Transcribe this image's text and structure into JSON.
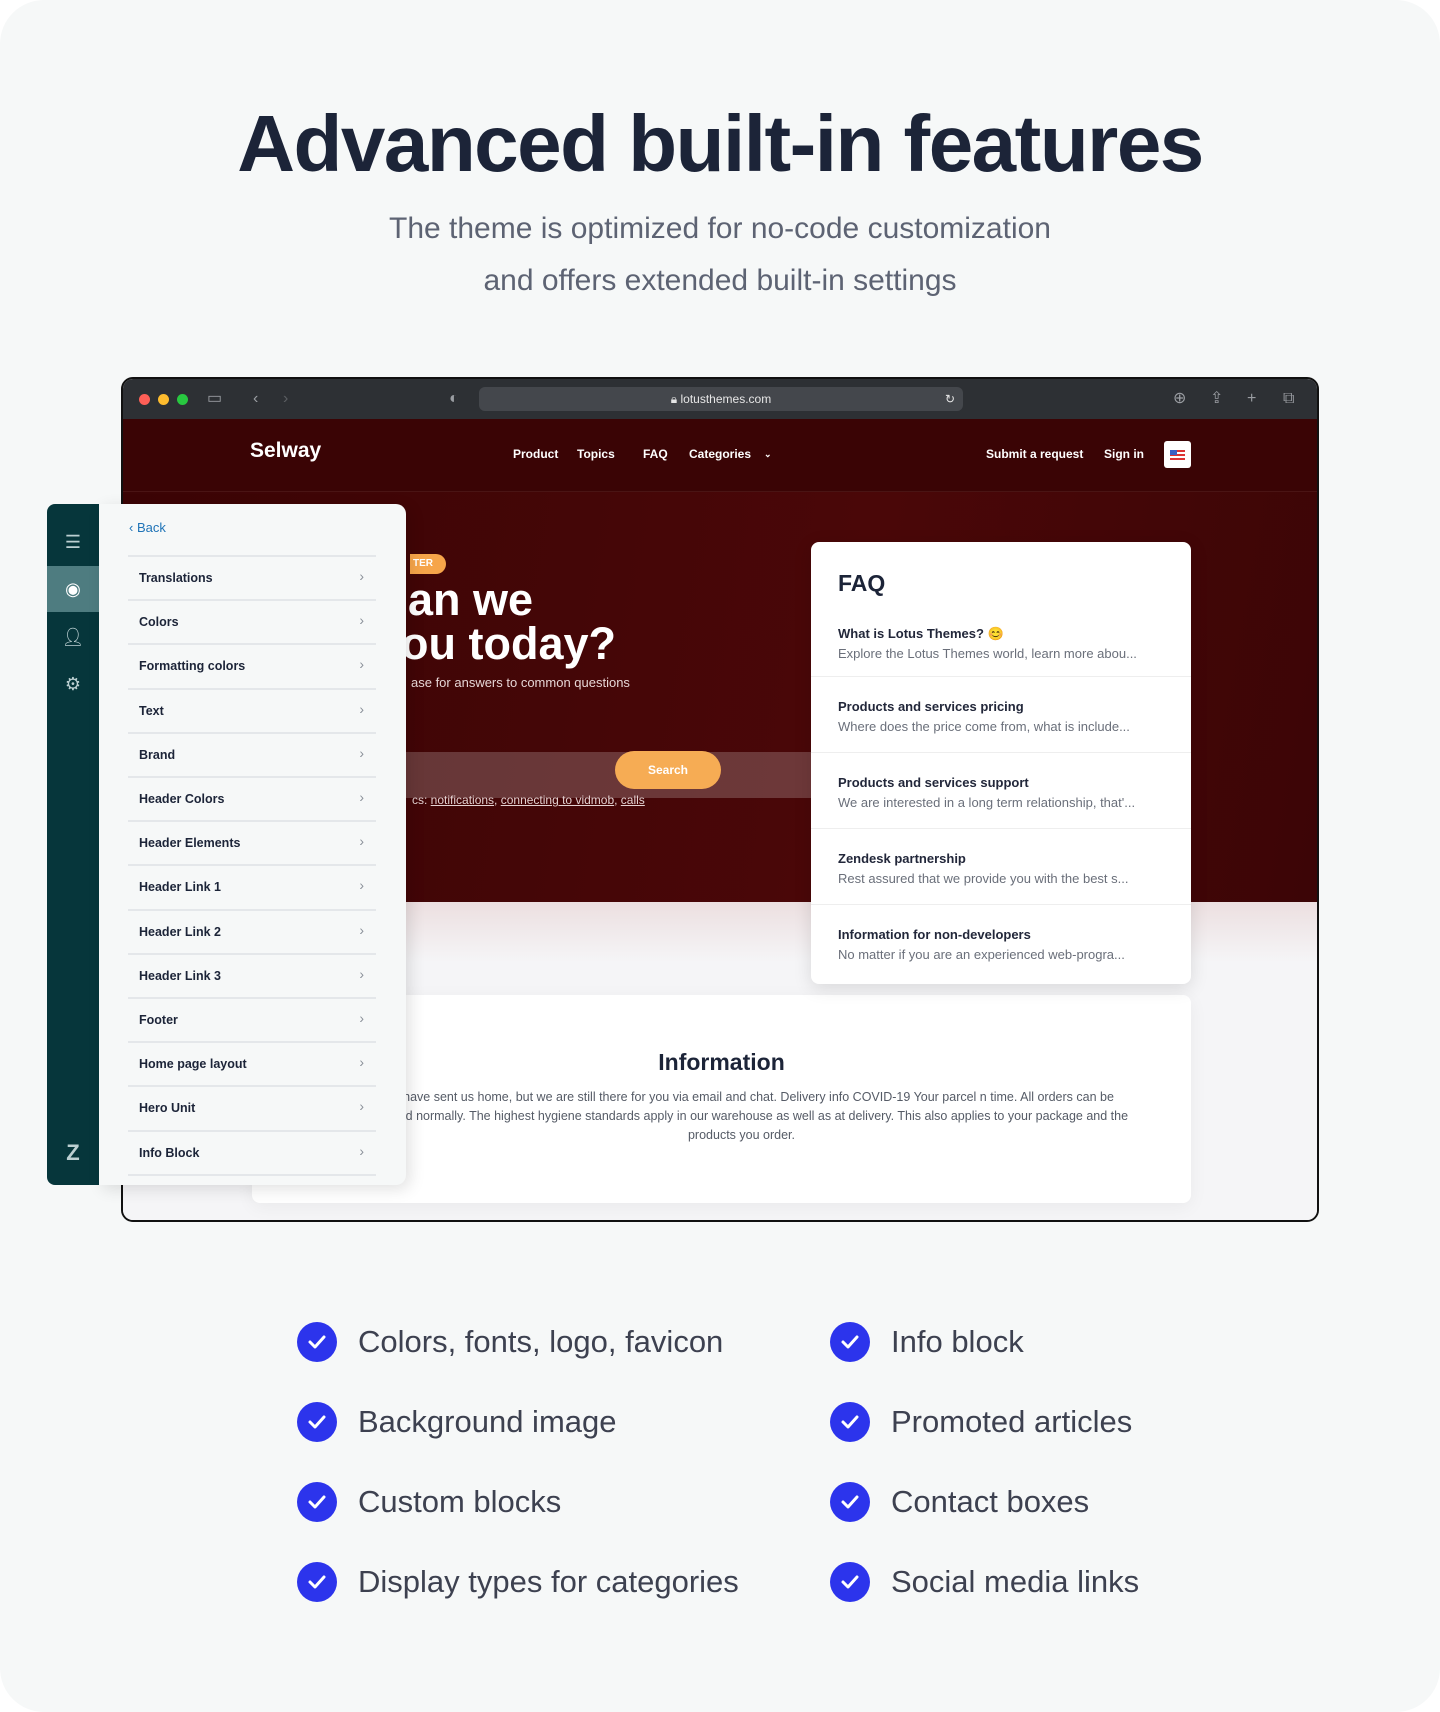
{
  "hero_section": {
    "title": "Advanced built-in features",
    "subtitle_lines": [
      "The theme is optimized for no-code customization",
      "and offers extended built-in settings"
    ]
  },
  "browser": {
    "url": "lotusthemes.com"
  },
  "site": {
    "logo": "Selway",
    "nav": [
      "Product",
      "Topics",
      "FAQ",
      "Categories"
    ],
    "submit": "Submit a request",
    "signin": "Sign in",
    "hero": {
      "badge": "TER",
      "line1": "an we",
      "line2": "ou today?",
      "subtitle": "ase for answers to common questions",
      "search_button": "Search",
      "popular_prefix": "cs: ",
      "popular": [
        "notifications",
        "connecting to vidmob",
        "calls"
      ]
    },
    "faq": {
      "title": "FAQ",
      "items": [
        {
          "q": "What is Lotus Themes? 😊",
          "a": "Explore the Lotus Themes world, learn more abou..."
        },
        {
          "q": "Products and services pricing",
          "a": "Where does the price come from, what is include..."
        },
        {
          "q": "Products and services support",
          "a": "We are interested in a long term relationship, that'..."
        },
        {
          "q": "Zendesk partnership",
          "a": "Rest assured that we provide you with the best s..."
        },
        {
          "q": "Information for non-developers",
          "a": "No matter if you are an experienced web-progra..."
        }
      ]
    },
    "info": {
      "title": "Information",
      "text": "might have sent us home, but we are still there for you via email and chat. Delivery info COVID-19 Your parcel n time. All orders can be processed normally. The highest hygiene standards apply in our warehouse as well as at delivery. This also applies to your package and the products you order."
    }
  },
  "panel": {
    "back": "Back",
    "items": [
      "Translations",
      "Colors",
      "Formatting colors",
      "Text",
      "Brand",
      "Header Colors",
      "Header Elements",
      "Header Link 1",
      "Header Link 2",
      "Header Link 3",
      "Footer",
      "Home page layout",
      "Hero Unit",
      "Info Block"
    ]
  },
  "features": {
    "left": [
      "Colors, fonts, logo, favicon",
      "Background image",
      "Custom blocks",
      "Display types for categories"
    ],
    "right": [
      "Info block",
      "Promoted articles",
      "Contact boxes",
      "Social media links"
    ]
  },
  "colors": {
    "accent": "#2c34ec",
    "header_bg": "#3a0405",
    "search_button": "#f6ac54",
    "rail": "#06363b"
  }
}
